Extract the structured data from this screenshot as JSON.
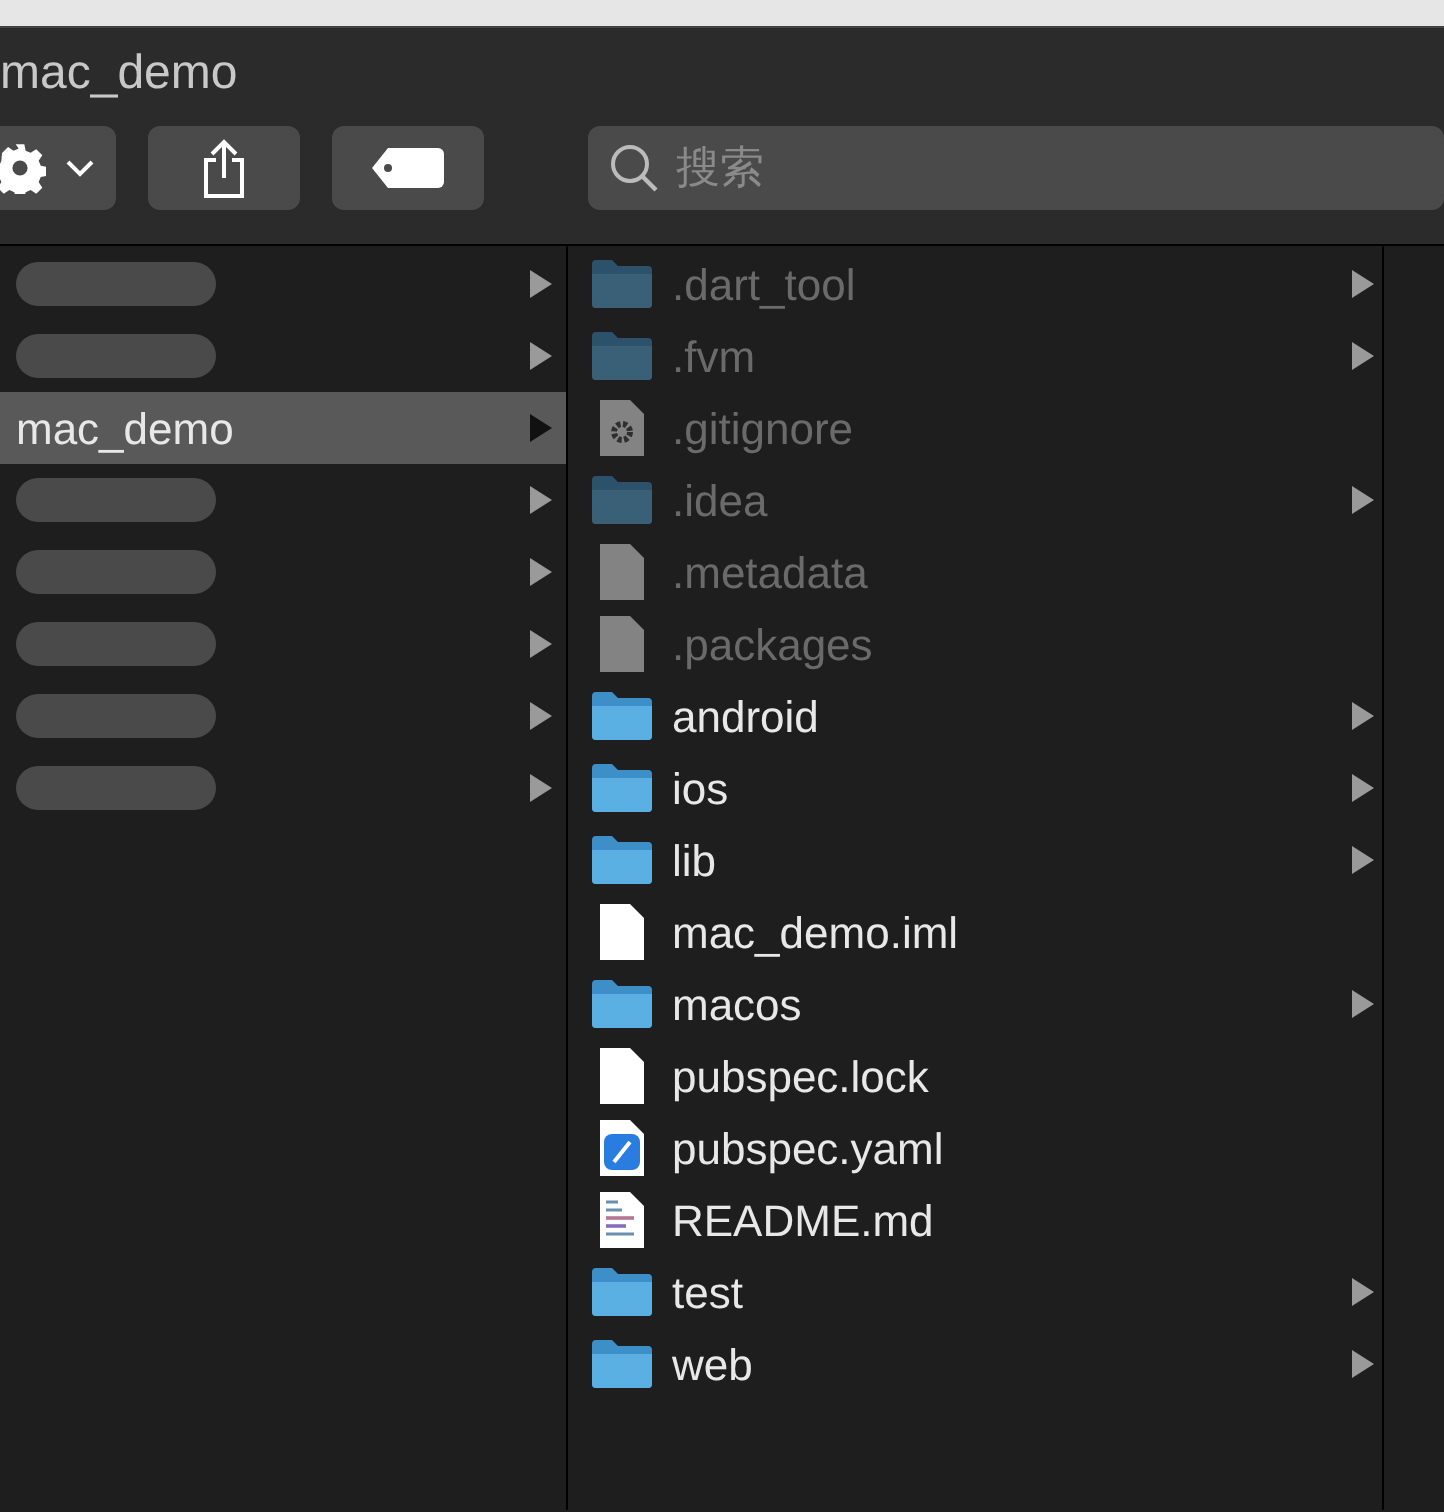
{
  "window": {
    "title": "mac_demo"
  },
  "toolbar": {
    "search": {
      "placeholder": "搜索"
    }
  },
  "columns": [
    {
      "items": [
        {
          "redacted": true,
          "selected": false,
          "expandable": true
        },
        {
          "redacted": true,
          "selected": false,
          "expandable": true
        },
        {
          "name": "mac_demo",
          "redacted": false,
          "selected": true,
          "expandable": true
        },
        {
          "redacted": true,
          "selected": false,
          "expandable": true
        },
        {
          "redacted": true,
          "selected": false,
          "expandable": true
        },
        {
          "redacted": true,
          "selected": false,
          "expandable": true
        },
        {
          "redacted": true,
          "selected": false,
          "expandable": true
        },
        {
          "redacted": true,
          "selected": false,
          "expandable": true
        }
      ]
    },
    {
      "items": [
        {
          "name": ".dart_tool",
          "kind": "folder",
          "hidden": true,
          "expandable": true
        },
        {
          "name": ".fvm",
          "kind": "folder",
          "hidden": true,
          "expandable": true
        },
        {
          "name": ".gitignore",
          "kind": "config",
          "hidden": true,
          "expandable": false
        },
        {
          "name": ".idea",
          "kind": "folder",
          "hidden": true,
          "expandable": true
        },
        {
          "name": ".metadata",
          "kind": "file",
          "hidden": true,
          "expandable": false
        },
        {
          "name": ".packages",
          "kind": "file",
          "hidden": true,
          "expandable": false
        },
        {
          "name": "android",
          "kind": "folder",
          "hidden": false,
          "expandable": true
        },
        {
          "name": "ios",
          "kind": "folder",
          "hidden": false,
          "expandable": true
        },
        {
          "name": "lib",
          "kind": "folder",
          "hidden": false,
          "expandable": true
        },
        {
          "name": "mac_demo.iml",
          "kind": "file",
          "hidden": false,
          "expandable": false
        },
        {
          "name": "macos",
          "kind": "folder",
          "hidden": false,
          "expandable": true
        },
        {
          "name": "pubspec.lock",
          "kind": "file",
          "hidden": false,
          "expandable": false
        },
        {
          "name": "pubspec.yaml",
          "kind": "xcode",
          "hidden": false,
          "expandable": false
        },
        {
          "name": "README.md",
          "kind": "text",
          "hidden": false,
          "expandable": false
        },
        {
          "name": "test",
          "kind": "folder",
          "hidden": false,
          "expandable": true
        },
        {
          "name": "web",
          "kind": "folder",
          "hidden": false,
          "expandable": true
        }
      ]
    }
  ]
}
